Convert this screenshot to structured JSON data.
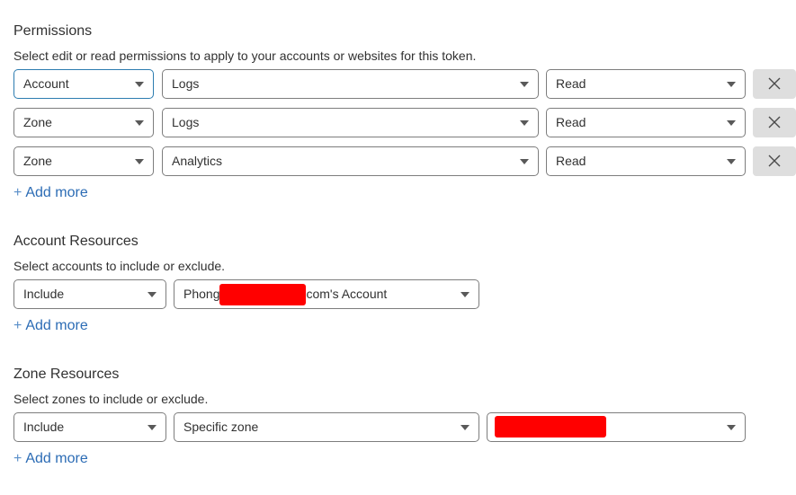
{
  "permissions": {
    "title": "Permissions",
    "description": "Select edit or read permissions to apply to your accounts or websites for this token.",
    "rows": [
      {
        "scope": "Account",
        "resource": "Logs",
        "access": "Read"
      },
      {
        "scope": "Zone",
        "resource": "Logs",
        "access": "Read"
      },
      {
        "scope": "Zone",
        "resource": "Analytics",
        "access": "Read"
      }
    ],
    "remove_icon": "close-icon",
    "add_more_label": "Add more",
    "add_more_icon": "+"
  },
  "account_resources": {
    "title": "Account Resources",
    "description": "Select accounts to include or exclude.",
    "mode": "Include",
    "account_prefix": "Phong",
    "account_suffix": "com's Account",
    "add_more_label": "Add more",
    "add_more_icon": "+"
  },
  "zone_resources": {
    "title": "Zone Resources",
    "description": "Select zones to include or exclude.",
    "mode": "Include",
    "zone_type": "Specific zone",
    "add_more_label": "Add more",
    "add_more_icon": "+"
  },
  "colors": {
    "link": "#2c6cb5",
    "focus_border": "#2c7cb0",
    "redaction": "#ff0000",
    "remove_button_bg": "#dedede"
  }
}
